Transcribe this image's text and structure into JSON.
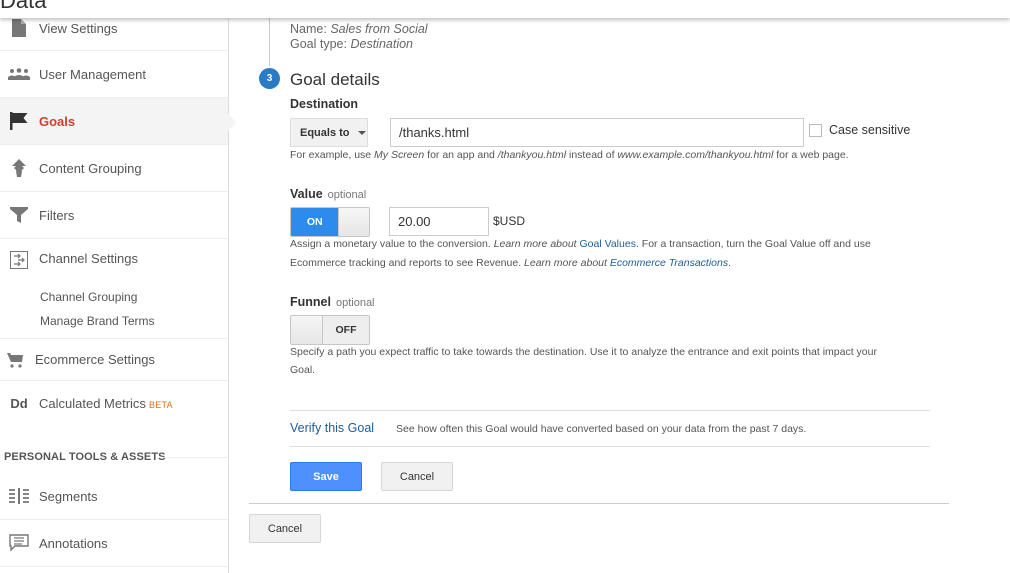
{
  "header": {
    "title": "Data"
  },
  "sidebar": {
    "items": [
      {
        "label": "View Settings",
        "icon": "document-icon"
      },
      {
        "label": "User Management",
        "icon": "users-icon"
      },
      {
        "label": "Goals",
        "icon": "flag-icon",
        "active": true
      },
      {
        "label": "Content Grouping",
        "icon": "content-grouping-icon"
      },
      {
        "label": "Filters",
        "icon": "filter-icon"
      },
      {
        "label": "Channel Settings",
        "icon": "channel-settings-icon"
      },
      {
        "label": "Ecommerce Settings",
        "icon": "cart-icon"
      },
      {
        "label": "Calculated Metrics",
        "icon": "dd-icon",
        "badge": "BETA"
      },
      {
        "label": "Segments",
        "icon": "segments-icon"
      },
      {
        "label": "Annotations",
        "icon": "annotation-icon"
      }
    ],
    "sub_items": [
      "Channel Grouping",
      "Manage Brand Terms"
    ],
    "dd_glyph": "Dd",
    "section_heading": "PERSONAL TOOLS & ASSETS"
  },
  "goal_summary": {
    "name_label": "Name:",
    "name_value": "Sales from Social",
    "type_label": "Goal type:",
    "type_value": "Destination"
  },
  "goal_details": {
    "step_number": "3",
    "title": "Goal details",
    "destination": {
      "label": "Destination",
      "match_type": "Equals to",
      "value": "/thanks.html",
      "case_sensitive_label": "Case sensitive",
      "case_sensitive_checked": false,
      "help": {
        "p1": "For example, use ",
        "e1": "My Screen",
        "p2": " for an app and ",
        "e2": "/thankyou.html",
        "p3": " instead of ",
        "e3": "www.example.com/thankyou.html",
        "p4": " for a web page."
      }
    },
    "value": {
      "label": "Value",
      "optional": "optional",
      "toggle_state": "ON",
      "amount": "20.00",
      "currency": "$USD",
      "help": {
        "p1": "Assign a monetary value to the conversion. ",
        "e1": "Learn more about ",
        "l1": "Goal Values",
        "p2": ". For a transaction, turn the Goal Value off and use",
        "p3": "Ecommerce tracking and reports to see Revenue. ",
        "e2": "Learn more about ",
        "l2": "Ecommerce Transactions",
        "p4": "."
      }
    },
    "funnel": {
      "label": "Funnel",
      "optional": "optional",
      "toggle_state": "OFF",
      "help_line1": "Specify a path you expect traffic to take towards the destination. Use it to analyze the entrance and exit points that impact your",
      "help_line2": "Goal."
    },
    "verify": {
      "link": "Verify this Goal",
      "description": "See how often this Goal would have converted based on your data from the past 7 days."
    },
    "save_label": "Save",
    "cancel_label": "Cancel"
  },
  "footer": {
    "cancel_label": "Cancel"
  },
  "colors": {
    "accent": "#4d90fe",
    "active_nav": "#d23f31",
    "toggle_on": "#2d8ceb",
    "step_badge": "#2a7ac4",
    "link": "#1f5d99",
    "beta": "#e06f1a"
  }
}
